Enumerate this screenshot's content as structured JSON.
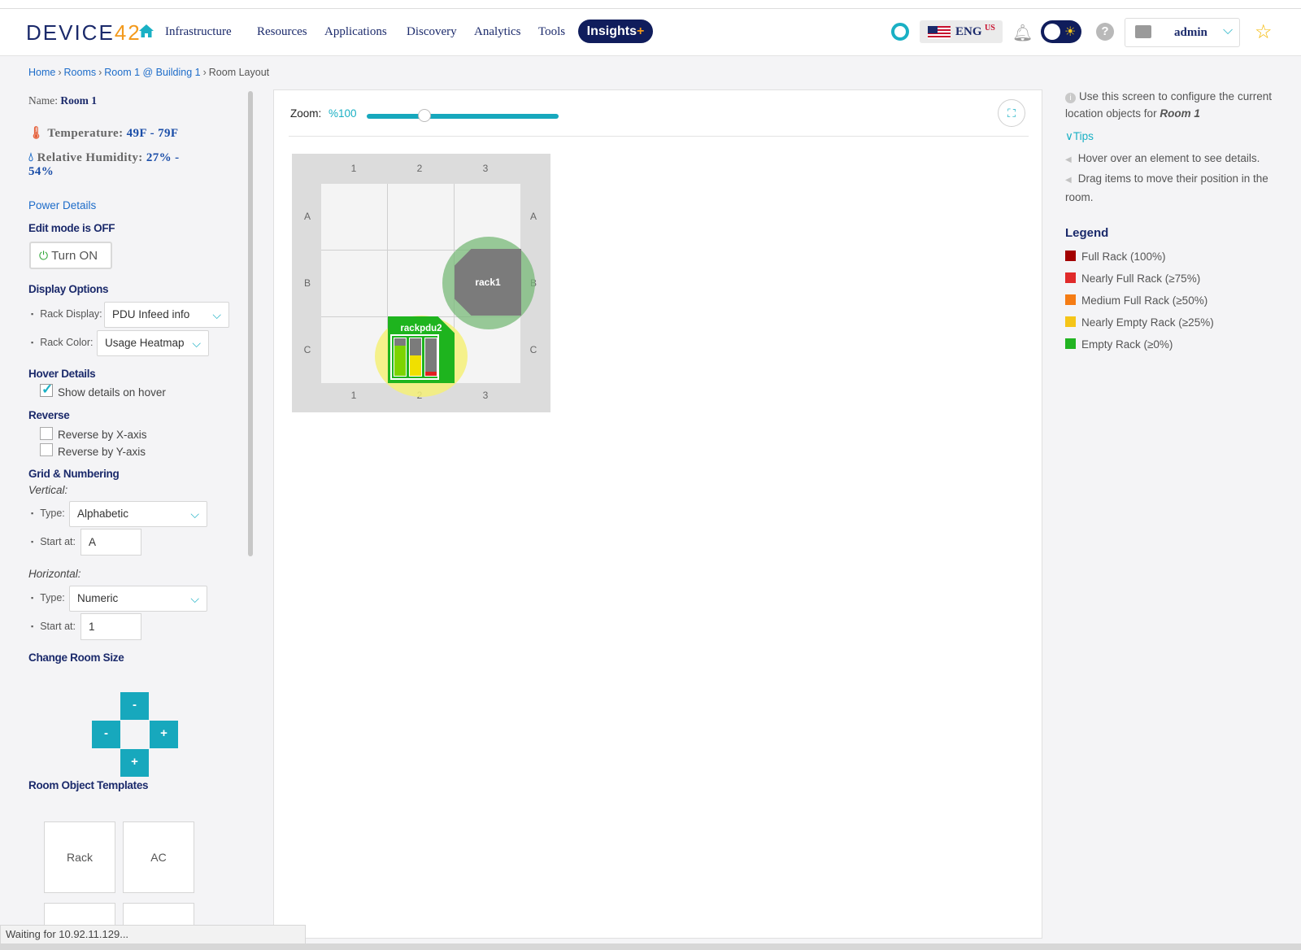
{
  "app": {
    "logo_pre": "DEVICE",
    "logo_num": "42"
  },
  "nav": {
    "items": [
      "Infrastructure",
      "Resources",
      "Applications",
      "Discovery",
      "Analytics",
      "Tools"
    ],
    "insights_label": "Insights",
    "insights_plus": "+",
    "lang": "ENG",
    "lang_region": "US",
    "user": "admin"
  },
  "breadcrumb": {
    "home": "Home",
    "rooms": "Rooms",
    "room": "Room 1 @ Building 1",
    "current": "Room Layout"
  },
  "sidebar": {
    "name_label": "Name:",
    "name_value": "Room 1",
    "temp_label": "Temperature:",
    "temp_value": "49F - 79F",
    "humidity_label": "Relative Humidity:",
    "humidity_value_1": "27% -",
    "humidity_value_2": "54%",
    "power_details": "Power Details",
    "edit_mode": "Edit mode is OFF",
    "turn_on": "Turn ON",
    "display_options": "Display Options",
    "rack_display_label": "Rack Display:",
    "rack_display_value": "PDU Infeed info",
    "rack_color_label": "Rack Color:",
    "rack_color_value": "Usage Heatmap",
    "hover_details": "Hover Details",
    "show_details": "Show details on hover",
    "show_details_checked": true,
    "reverse": "Reverse",
    "reverse_x": "Reverse by X-axis",
    "reverse_y": "Reverse by Y-axis",
    "grid_numbering": "Grid & Numbering",
    "vertical": "Vertical:",
    "v_type_label": "Type:",
    "v_type_value": "Alphabetic",
    "v_start_label": "Start at:",
    "v_start_value": "A",
    "horizontal": "Horizontal:",
    "h_type_label": "Type:",
    "h_type_value": "Numeric",
    "h_start_label": "Start at:",
    "h_start_value": "1",
    "change_room_size": "Change Room Size",
    "minus": "-",
    "plus": "+",
    "room_object_templates": "Room Object Templates",
    "templates": [
      "Rack",
      "AC"
    ]
  },
  "canvas": {
    "zoom_label": "Zoom:",
    "zoom_value": "%100",
    "zoom_fraction": 0.3,
    "cols": [
      "1",
      "2",
      "3"
    ],
    "rows": [
      "A",
      "B",
      "C"
    ],
    "rack1_label": "rack1",
    "rackpdu2_label": "rackpdu2",
    "pdu_bars": [
      {
        "fill_fraction": 0.8,
        "color": "#7dd400"
      },
      {
        "fill_fraction": 0.55,
        "color": "#f0e000"
      },
      {
        "fill_fraction": 0.1,
        "color": "#e22020"
      }
    ]
  },
  "help": {
    "info_text": "Use this screen to configure the current location objects for",
    "info_room": "Room 1",
    "tips_label": "Tips",
    "tip_1": "Hover over an element to see details.",
    "tip_2": "Drag items to move their position in the room."
  },
  "legend": {
    "title": "Legend",
    "items": [
      {
        "label": "Full Rack (100%)",
        "color": "#a30000"
      },
      {
        "label": "Nearly Full Rack (≥75%)",
        "color": "#e02a2a"
      },
      {
        "label": "Medium Full Rack (≥50%)",
        "color": "#f57c14"
      },
      {
        "label": "Nearly Empty Rack (≥25%)",
        "color": "#f5c518"
      },
      {
        "label": "Empty Rack (≥0%)",
        "color": "#22b422"
      }
    ]
  },
  "status_bar": "Waiting for 10.92.11.129...",
  "colors": {
    "accent": "#1ab0c4",
    "navy": "#1b2a6b",
    "brand_orange": "#f39a1d"
  }
}
